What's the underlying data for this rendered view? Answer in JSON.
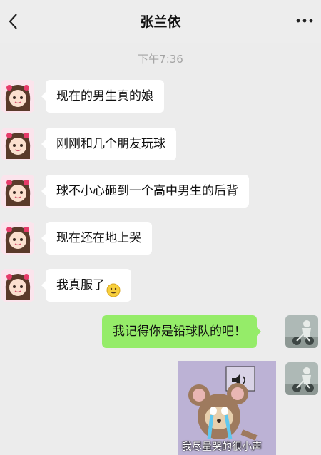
{
  "header": {
    "title": "张兰依"
  },
  "timestamp": "下午7:36",
  "messages_left": [
    {
      "text": "现在的男生真的娘"
    },
    {
      "text": "刚刚和几个朋友玩球"
    },
    {
      "text": "球不小心砸到一个高中男生的后背"
    },
    {
      "text": "现在还在地上哭"
    },
    {
      "text": "我真服了",
      "emoji": "smile-emoji"
    }
  ],
  "messages_right": [
    {
      "text": "我记得你是铅球队的吧！"
    }
  ],
  "sticker": {
    "caption": "我尽量哭的很小声",
    "icon": "crying-mouse-sticker"
  },
  "icons": {
    "back": "back-chevron-icon",
    "more": "more-dots-icon"
  },
  "colors": {
    "background": "#ececec",
    "bubble_left": "#ffffff",
    "bubble_right": "#95ec69",
    "timestamp": "#a3a3a3"
  }
}
